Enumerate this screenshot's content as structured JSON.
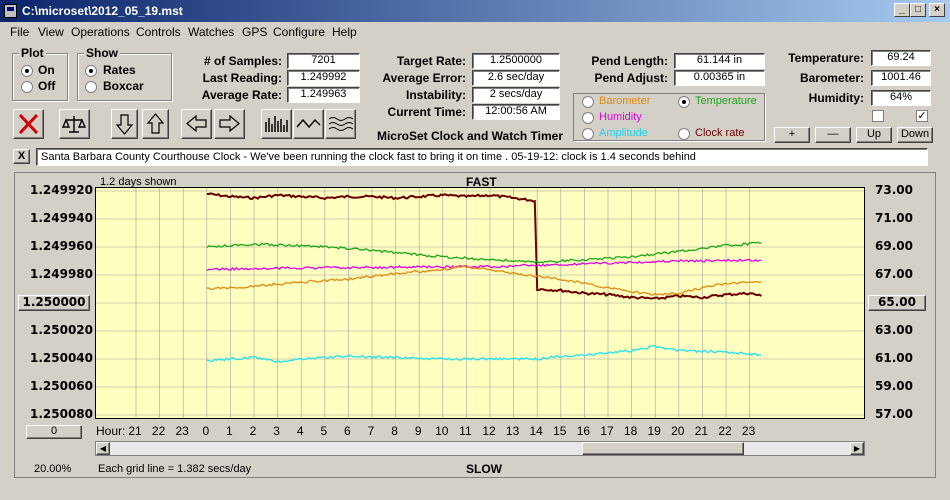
{
  "window": {
    "title": "C:\\microset\\2012_05_19.mst",
    "min": "_",
    "max": "□",
    "close": "×"
  },
  "menu": [
    "File",
    "View",
    "Operations",
    "Controls",
    "Watches",
    "GPS",
    "Configure",
    "Help"
  ],
  "plot_group": {
    "title": "Plot",
    "on": "On",
    "off": "Off"
  },
  "show_group": {
    "title": "Show",
    "rates": "Rates",
    "boxcar": "Boxcar"
  },
  "stats": {
    "samples_label": "# of Samples:",
    "samples": "7201",
    "last_label": "Last Reading:",
    "last": "1.249992",
    "avg_rate_label": "Average Rate:",
    "avg_rate": "1.249963"
  },
  "rates": {
    "target_label": "Target Rate:",
    "target": "1.2500000",
    "avg_err_label": "Average Error:",
    "avg_err": "2.6 sec/day",
    "instab_label": "Instability:",
    "instab": "2 secs/day",
    "time_label": "Current Time:",
    "time": "12:00:56 AM"
  },
  "app_name": "MicroSet Clock and Watch Timer",
  "pend": {
    "length_label": "Pend Length:",
    "length": "61.144 in",
    "adjust_label": "Pend Adjust:",
    "adjust": "0.00365 in"
  },
  "sensors": {
    "temp_label": "Temperature:",
    "temp": "69.24",
    "baro_label": "Barometer:",
    "baro": "1001.46",
    "hum_label": "Humidity:",
    "hum": "64%"
  },
  "series_select": {
    "barometer": "Barometer",
    "temperature": "Temperature",
    "humidity": "Humidity",
    "amplitude": "Amplitude",
    "clock_rate": "Clock rate"
  },
  "right_buttons": {
    "plus": "+",
    "minus": "—",
    "up": "Up",
    "down": "Down"
  },
  "checks": {
    "c1": "",
    "c2": "✓"
  },
  "note": "Santa Barbara County Courthouse Clock - We've been running the clock fast to bring it on time .   05-19-12: clock is 1.4 seconds behind",
  "note_close": "X",
  "colors": {
    "clock_rate": "#6a0000",
    "temperature": "#1aa51a",
    "humidity": "#e000e0",
    "barometer": "#e08a10",
    "amplitude": "#20e0f0"
  },
  "chart_data": {
    "type": "line",
    "top_label": "FAST",
    "bottom_label": "SLOW",
    "days_shown": "1.2 days shown",
    "grid_note": "Each grid line = 1.382 secs/day",
    "zoom": "20.00%",
    "left_axis": {
      "ticks": [
        "1.249920",
        "1.249940",
        "1.249960",
        "1.249980",
        "1.250000",
        "1.250020",
        "1.250040",
        "1.250060",
        "1.250080"
      ],
      "range": [
        1.24992,
        1.25008
      ],
      "inverted": true,
      "selected": "1.250000"
    },
    "right_axis": {
      "ticks": [
        "73.00",
        "71.00",
        "69.00",
        "67.00",
        "65.00",
        "63.00",
        "61.00",
        "59.00",
        "57.00"
      ],
      "range": [
        57,
        73
      ],
      "selected": "65.00"
    },
    "x_label": "Hour:",
    "x_ticks": [
      "21",
      "22",
      "23",
      "0",
      "1",
      "2",
      "3",
      "4",
      "5",
      "6",
      "7",
      "8",
      "9",
      "10",
      "11",
      "12",
      "13",
      "14",
      "15",
      "16",
      "17",
      "18",
      "19",
      "20",
      "21",
      "22",
      "23"
    ],
    "left_button": "0",
    "series": [
      {
        "name": "Clock rate",
        "color": "#6a0000",
        "x": [
          0,
          1,
          2,
          3,
          4,
          5,
          6,
          7,
          8,
          9,
          10,
          11,
          12,
          13,
          13.9,
          14,
          15,
          16,
          17,
          18,
          19,
          20,
          21,
          22,
          23,
          23.5
        ],
        "y": [
          1.249922,
          1.249924,
          1.249925,
          1.249923,
          1.249924,
          1.249925,
          1.249924,
          1.249924,
          1.249925,
          1.249924,
          1.249923,
          1.249924,
          1.249923,
          1.249925,
          1.249927,
          1.24999,
          1.249991,
          1.249993,
          1.249994,
          1.249996,
          1.249997,
          1.249995,
          1.249996,
          1.249994,
          1.249993,
          1.249995
        ]
      },
      {
        "name": "Temperature",
        "color": "#1aa51a",
        "x": [
          0,
          2,
          4,
          6,
          8,
          10,
          12,
          14,
          16,
          18,
          20,
          22,
          23.5
        ],
        "y": [
          69.0,
          69.2,
          69.1,
          68.9,
          68.6,
          68.3,
          68.1,
          67.9,
          68.1,
          68.3,
          68.7,
          69.1,
          69.3
        ]
      },
      {
        "name": "Humidity",
        "color": "#e000e0",
        "x": [
          0,
          4,
          8,
          12,
          16,
          20,
          23.5
        ],
        "y": [
          67.4,
          67.5,
          67.55,
          67.6,
          67.8,
          68.0,
          68.05
        ]
      },
      {
        "name": "Barometer",
        "color": "#e08a10",
        "x": [
          0,
          2,
          4,
          6,
          8,
          10,
          11,
          12,
          13,
          14,
          15,
          16,
          17,
          18,
          19,
          20,
          21,
          22,
          23.5
        ],
        "y": [
          66.0,
          66.2,
          66.5,
          66.7,
          67.1,
          67.4,
          67.6,
          67.4,
          67.1,
          66.9,
          66.7,
          66.4,
          66.1,
          65.8,
          65.6,
          65.7,
          66.1,
          66.4,
          66.5
        ]
      },
      {
        "name": "Amplitude",
        "color": "#20e0f0",
        "x": [
          0,
          2,
          3,
          4,
          6,
          8,
          10,
          12,
          14,
          15,
          16,
          18,
          19,
          20,
          22,
          23.5
        ],
        "y": [
          60.9,
          61.1,
          60.8,
          61.0,
          61.2,
          61.1,
          61.0,
          61.0,
          61.0,
          61.2,
          61.3,
          61.6,
          61.9,
          61.6,
          61.5,
          61.3
        ]
      }
    ]
  }
}
